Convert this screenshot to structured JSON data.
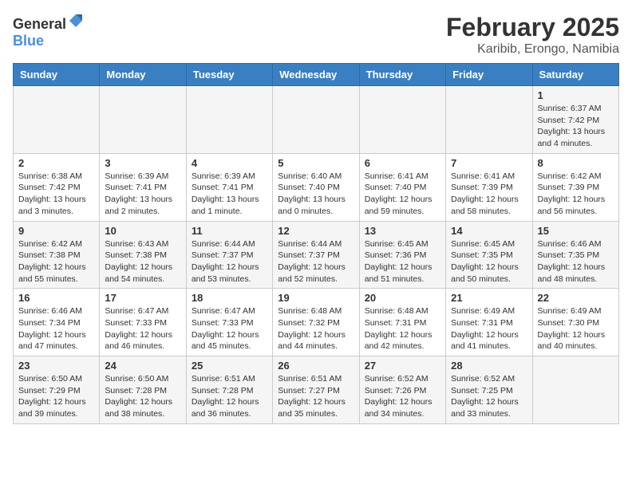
{
  "header": {
    "logo_general": "General",
    "logo_blue": "Blue",
    "month_year": "February 2025",
    "location": "Karibib, Erongo, Namibia"
  },
  "weekdays": [
    "Sunday",
    "Monday",
    "Tuesday",
    "Wednesday",
    "Thursday",
    "Friday",
    "Saturday"
  ],
  "weeks": [
    [
      {
        "day": "",
        "info": ""
      },
      {
        "day": "",
        "info": ""
      },
      {
        "day": "",
        "info": ""
      },
      {
        "day": "",
        "info": ""
      },
      {
        "day": "",
        "info": ""
      },
      {
        "day": "",
        "info": ""
      },
      {
        "day": "1",
        "info": "Sunrise: 6:37 AM\nSunset: 7:42 PM\nDaylight: 13 hours and 4 minutes."
      }
    ],
    [
      {
        "day": "2",
        "info": "Sunrise: 6:38 AM\nSunset: 7:42 PM\nDaylight: 13 hours and 3 minutes."
      },
      {
        "day": "3",
        "info": "Sunrise: 6:39 AM\nSunset: 7:41 PM\nDaylight: 13 hours and 2 minutes."
      },
      {
        "day": "4",
        "info": "Sunrise: 6:39 AM\nSunset: 7:41 PM\nDaylight: 13 hours and 1 minute."
      },
      {
        "day": "5",
        "info": "Sunrise: 6:40 AM\nSunset: 7:40 PM\nDaylight: 13 hours and 0 minutes."
      },
      {
        "day": "6",
        "info": "Sunrise: 6:41 AM\nSunset: 7:40 PM\nDaylight: 12 hours and 59 minutes."
      },
      {
        "day": "7",
        "info": "Sunrise: 6:41 AM\nSunset: 7:39 PM\nDaylight: 12 hours and 58 minutes."
      },
      {
        "day": "8",
        "info": "Sunrise: 6:42 AM\nSunset: 7:39 PM\nDaylight: 12 hours and 56 minutes."
      }
    ],
    [
      {
        "day": "9",
        "info": "Sunrise: 6:42 AM\nSunset: 7:38 PM\nDaylight: 12 hours and 55 minutes."
      },
      {
        "day": "10",
        "info": "Sunrise: 6:43 AM\nSunset: 7:38 PM\nDaylight: 12 hours and 54 minutes."
      },
      {
        "day": "11",
        "info": "Sunrise: 6:44 AM\nSunset: 7:37 PM\nDaylight: 12 hours and 53 minutes."
      },
      {
        "day": "12",
        "info": "Sunrise: 6:44 AM\nSunset: 7:37 PM\nDaylight: 12 hours and 52 minutes."
      },
      {
        "day": "13",
        "info": "Sunrise: 6:45 AM\nSunset: 7:36 PM\nDaylight: 12 hours and 51 minutes."
      },
      {
        "day": "14",
        "info": "Sunrise: 6:45 AM\nSunset: 7:35 PM\nDaylight: 12 hours and 50 minutes."
      },
      {
        "day": "15",
        "info": "Sunrise: 6:46 AM\nSunset: 7:35 PM\nDaylight: 12 hours and 48 minutes."
      }
    ],
    [
      {
        "day": "16",
        "info": "Sunrise: 6:46 AM\nSunset: 7:34 PM\nDaylight: 12 hours and 47 minutes."
      },
      {
        "day": "17",
        "info": "Sunrise: 6:47 AM\nSunset: 7:33 PM\nDaylight: 12 hours and 46 minutes."
      },
      {
        "day": "18",
        "info": "Sunrise: 6:47 AM\nSunset: 7:33 PM\nDaylight: 12 hours and 45 minutes."
      },
      {
        "day": "19",
        "info": "Sunrise: 6:48 AM\nSunset: 7:32 PM\nDaylight: 12 hours and 44 minutes."
      },
      {
        "day": "20",
        "info": "Sunrise: 6:48 AM\nSunset: 7:31 PM\nDaylight: 12 hours and 42 minutes."
      },
      {
        "day": "21",
        "info": "Sunrise: 6:49 AM\nSunset: 7:31 PM\nDaylight: 12 hours and 41 minutes."
      },
      {
        "day": "22",
        "info": "Sunrise: 6:49 AM\nSunset: 7:30 PM\nDaylight: 12 hours and 40 minutes."
      }
    ],
    [
      {
        "day": "23",
        "info": "Sunrise: 6:50 AM\nSunset: 7:29 PM\nDaylight: 12 hours and 39 minutes."
      },
      {
        "day": "24",
        "info": "Sunrise: 6:50 AM\nSunset: 7:28 PM\nDaylight: 12 hours and 38 minutes."
      },
      {
        "day": "25",
        "info": "Sunrise: 6:51 AM\nSunset: 7:28 PM\nDaylight: 12 hours and 36 minutes."
      },
      {
        "day": "26",
        "info": "Sunrise: 6:51 AM\nSunset: 7:27 PM\nDaylight: 12 hours and 35 minutes."
      },
      {
        "day": "27",
        "info": "Sunrise: 6:52 AM\nSunset: 7:26 PM\nDaylight: 12 hours and 34 minutes."
      },
      {
        "day": "28",
        "info": "Sunrise: 6:52 AM\nSunset: 7:25 PM\nDaylight: 12 hours and 33 minutes."
      },
      {
        "day": "",
        "info": ""
      }
    ]
  ]
}
